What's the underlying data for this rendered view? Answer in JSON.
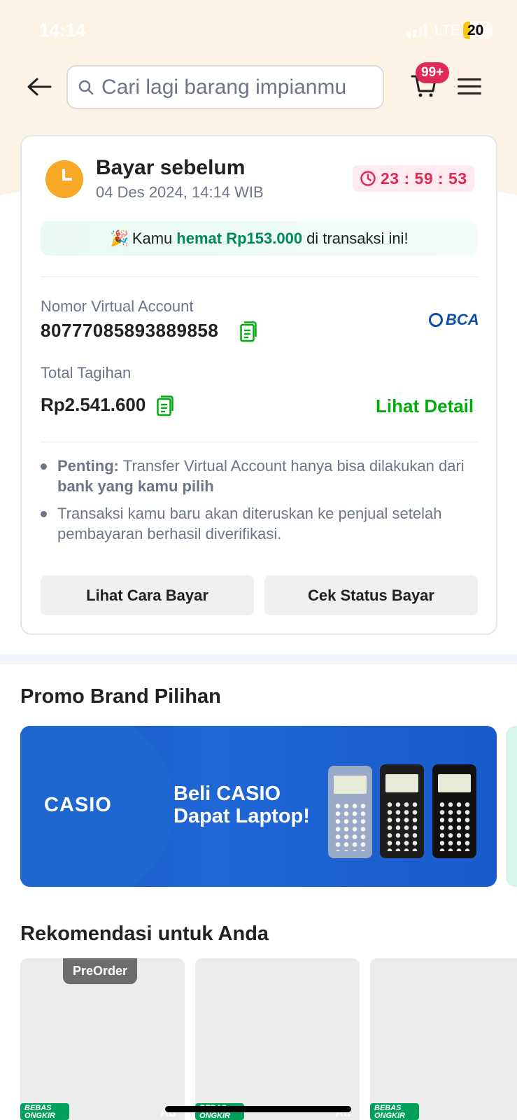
{
  "status_bar": {
    "time": "14:14",
    "network": "LTE",
    "battery": "20"
  },
  "header": {
    "search_placeholder": "Cari lagi barang impianmu",
    "cart_badge": "99+"
  },
  "payment": {
    "pay_before_title": "Bayar sebelum",
    "deadline": "04 Des 2024, 14:14 WIB",
    "countdown": "23 : 59 : 53",
    "savings_prefix": "Kamu",
    "savings_amount": "hemat Rp153.000",
    "savings_suffix": "di transaksi ini!",
    "va_label": "Nomor Virtual Account",
    "va_number": "80777085893889858",
    "bank": "BCA",
    "total_label": "Total Tagihan",
    "total_amount": "Rp2.541.600",
    "detail_link": "Lihat Detail",
    "note1_bold": "Penting:",
    "note1_text": "Transfer Virtual Account hanya bisa dilakukan dari",
    "note1_bold2": "bank yang kamu pilih",
    "note2_text": "Transaksi kamu baru akan diteruskan ke penjual setelah pembayaran berhasil diverifikasi.",
    "btn_how_to_pay": "Lihat Cara Bayar",
    "btn_check_status": "Cek Status Bayar"
  },
  "promo": {
    "section_title": "Promo Brand Pilihan",
    "banner_brand": "CASIO",
    "banner_line1": "Beli CASIO",
    "banner_line2": "Dapat Laptop!"
  },
  "recommendations": {
    "section_title": "Rekomendasi untuk Anda",
    "preorder_label": "PreOrder",
    "free_shipping_line1": "BEBAS",
    "free_shipping_line2": "ONGKIR",
    "ad_label": "Ad"
  },
  "colors": {
    "accent_green": "#03ac0e",
    "savings_green": "#03875e",
    "timer_red": "#e02954",
    "clock_orange": "#f9a825",
    "bca_blue": "#0f4fa8"
  }
}
